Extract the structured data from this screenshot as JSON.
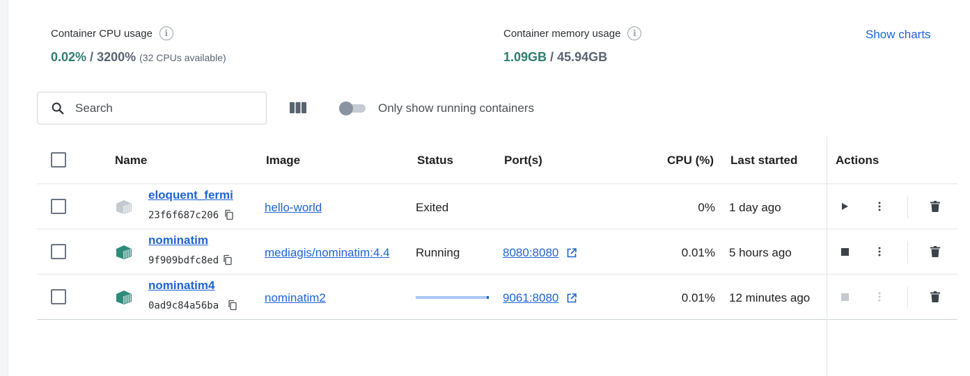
{
  "stats": {
    "cpu": {
      "label": "Container CPU usage",
      "used": "0.02%",
      "separator": " / ",
      "total": "3200%",
      "note": "(32 CPUs available)"
    },
    "memory": {
      "label": "Container memory usage",
      "used": "1.09GB",
      "separator": " / ",
      "total": "45.94GB"
    },
    "show_charts": "Show charts"
  },
  "toolbar": {
    "search_placeholder": "Search",
    "only_running_label": "Only show running containers",
    "only_running_enabled": false
  },
  "table": {
    "headers": {
      "name": "Name",
      "image": "Image",
      "status": "Status",
      "ports": "Port(s)",
      "cpu": "CPU (%)",
      "last_started": "Last started",
      "actions": "Actions"
    },
    "rows": [
      {
        "name": "eloquent_fermi",
        "id": "23f6f687c206",
        "image": "hello-world",
        "status": "Exited",
        "port": "",
        "cpu": "0%",
        "last_started": "1 day ago",
        "state": "exited"
      },
      {
        "name": "nominatim",
        "id": "9f909bdfc8ed",
        "image": "mediagis/nominatim:4.4",
        "status": "Running",
        "port": "8080:8080",
        "cpu": "0.01%",
        "last_started": "5 hours ago",
        "state": "running"
      },
      {
        "name": "nominatim4",
        "id": "0ad9c84a56ba",
        "image": "nominatim2",
        "status": "",
        "port": "9061:8080",
        "cpu": "0.01%",
        "last_started": "12 minutes ago",
        "state": "starting",
        "progress": 0.97
      }
    ]
  },
  "colors": {
    "accent": "#1d63d6",
    "running_icon": "#2e8b7a",
    "exited_icon": "#c4c9cf",
    "stat_value": "#2e7d6e"
  },
  "icons": [
    "info-icon",
    "search-icon",
    "columns-icon",
    "container-icon",
    "copy-icon",
    "external-link-icon",
    "play-icon",
    "stop-icon",
    "more-vert-icon",
    "trash-icon"
  ]
}
